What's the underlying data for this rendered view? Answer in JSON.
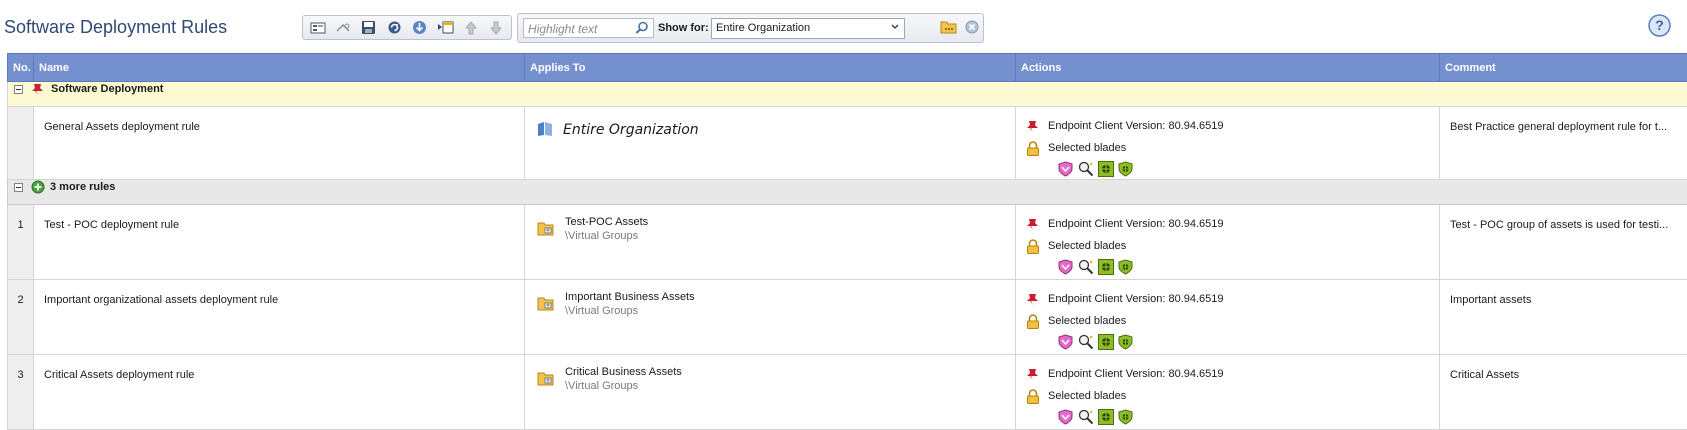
{
  "page": {
    "title": "Software Deployment Rules"
  },
  "toolbar": {
    "buttons": [
      {
        "name": "new-rule-button",
        "icon": "new-rule-icon"
      },
      {
        "name": "disable-button",
        "icon": "disable-icon"
      },
      {
        "name": "save-button",
        "icon": "save-icon"
      },
      {
        "name": "refresh-button",
        "icon": "refresh-icon"
      },
      {
        "name": "install-button",
        "icon": "install-icon"
      },
      {
        "name": "add-section-button",
        "icon": "add-section-icon"
      },
      {
        "name": "move-up-button",
        "icon": "arrow-up-icon"
      },
      {
        "name": "move-down-button",
        "icon": "arrow-down-icon"
      }
    ]
  },
  "filter": {
    "highlight_placeholder": "Highlight text",
    "show_for_label": "Show for:",
    "show_for_value": "Entire Organization"
  },
  "columns": {
    "no": "No.",
    "name": "Name",
    "applies_to": "Applies To",
    "actions": "Actions",
    "comment": "Comment"
  },
  "colors": {
    "header": "#7490cf",
    "section_yellow": "#fdfbd3",
    "section_grey": "#e8e8e8",
    "accent_title": "#2f4a73"
  },
  "section_default": {
    "label": "Software Deployment",
    "rule": {
      "name": "General Assets deployment rule",
      "applies_to": "Entire Organization",
      "action_version": "Endpoint Client Version: 80.94.6519",
      "action_blades": "Selected blades",
      "comment": "Best Practice general deployment rule for t..."
    }
  },
  "section_more": {
    "label": "3 more rules",
    "rules": [
      {
        "no": "1",
        "name": "Test - POC deployment rule",
        "group_name": "Test-POC Assets",
        "group_path": "\\Virtual Groups",
        "action_version": "Endpoint Client Version: 80.94.6519",
        "action_blades": "Selected blades",
        "comment": "Test - POC group of assets is used for testi..."
      },
      {
        "no": "2",
        "name": "Important organizational assets deployment rule",
        "group_name": "Important Business Assets",
        "group_path": "\\Virtual Groups",
        "action_version": "Endpoint Client Version: 80.94.6519",
        "action_blades": "Selected blades",
        "comment": "Important assets"
      },
      {
        "no": "3",
        "name": "Critical Assets deployment rule",
        "group_name": "Critical Business Assets",
        "group_path": "\\Virtual Groups",
        "action_version": "Endpoint Client Version: 80.94.6519",
        "action_blades": "Selected blades",
        "comment": "Critical Assets"
      }
    ]
  }
}
